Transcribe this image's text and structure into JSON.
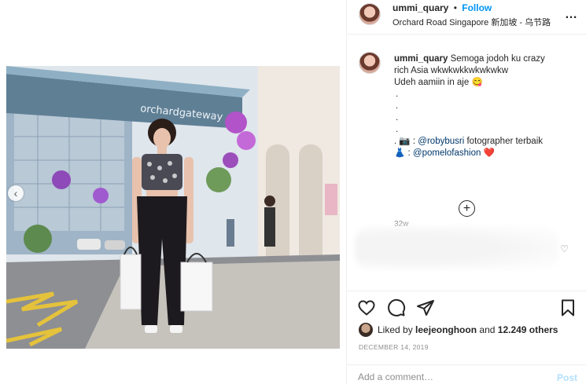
{
  "post": {
    "username": "ummi_quary",
    "follow_label": "Follow",
    "separator": "•",
    "location": "Orchard Road Singapore 新加坡 - 乌节路",
    "more_label": "…"
  },
  "photo": {
    "sign_text": "orchardgateway"
  },
  "caption": {
    "username": "ummi_quary",
    "line1": "Semoga jodoh ku crazy",
    "line2": "rich Asia wkwkwkkwkwkwkw",
    "line3": "Udeh aamiin in aje 😋",
    "dots": [
      ".",
      ".",
      ".",
      "."
    ],
    "camera_prefix": ". 📷 : ",
    "mention1": "@robybusri",
    "mention1_suffix": " fotographer terbaik",
    "dress_prefix": "👗 : ",
    "mention2": "@pomelofashion",
    "heart": "❤️",
    "time_ago": "32w"
  },
  "load_more_label": "+",
  "likes": {
    "prefix": "Liked by ",
    "user": "leejeonghoon",
    "middle": " and ",
    "count": "12.249 others"
  },
  "date": "DECEMBER 14, 2019",
  "comment_input": {
    "placeholder": "Add a comment…",
    "post_label": "Post"
  },
  "colors": {
    "follow": "#0095f6",
    "mention": "#00376b",
    "muted": "#8e8e8e",
    "post_disabled": "#b2dffc"
  }
}
